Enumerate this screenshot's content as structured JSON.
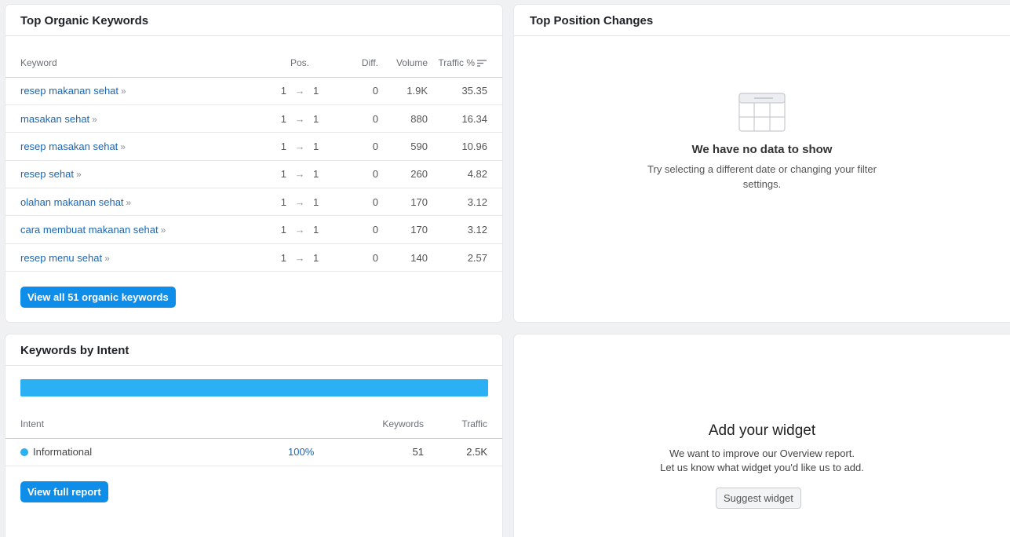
{
  "organic_keywords": {
    "title": "Top Organic Keywords",
    "columns": {
      "keyword": "Keyword",
      "pos": "Pos.",
      "diff": "Diff.",
      "volume": "Volume",
      "traffic": "Traffic %"
    },
    "rows": [
      {
        "keyword": "resep makanan sehat",
        "pos_from": "1",
        "pos_to": "1",
        "diff": "0",
        "volume": "1.9K",
        "traffic": "35.35"
      },
      {
        "keyword": "masakan sehat",
        "pos_from": "1",
        "pos_to": "1",
        "diff": "0",
        "volume": "880",
        "traffic": "16.34"
      },
      {
        "keyword": "resep masakan sehat",
        "pos_from": "1",
        "pos_to": "1",
        "diff": "0",
        "volume": "590",
        "traffic": "10.96"
      },
      {
        "keyword": "resep sehat",
        "pos_from": "1",
        "pos_to": "1",
        "diff": "0",
        "volume": "260",
        "traffic": "4.82"
      },
      {
        "keyword": "olahan makanan sehat",
        "pos_from": "1",
        "pos_to": "1",
        "diff": "0",
        "volume": "170",
        "traffic": "3.12"
      },
      {
        "keyword": "cara membuat makanan sehat",
        "pos_from": "1",
        "pos_to": "1",
        "diff": "0",
        "volume": "170",
        "traffic": "3.12"
      },
      {
        "keyword": "resep menu sehat",
        "pos_from": "1",
        "pos_to": "1",
        "diff": "0",
        "volume": "140",
        "traffic": "2.57"
      }
    ],
    "arrow_glyph": "→",
    "chevron_glyph": "»",
    "view_all_label": "View all 51 organic keywords"
  },
  "position_changes": {
    "title": "Top Position Changes",
    "empty_title": "We have no data to show",
    "empty_text": "Try selecting a different date or changing your filter settings."
  },
  "intent": {
    "title": "Keywords by Intent",
    "bar_fill_fraction": 1.0,
    "columns": {
      "intent": "Intent",
      "keywords": "Keywords",
      "traffic": "Traffic"
    },
    "rows": [
      {
        "intent": "Informational",
        "percent": "100%",
        "keywords": "51",
        "traffic": "2.5K",
        "color": "#2bb0f3"
      }
    ],
    "view_full_label": "View full report"
  },
  "widget": {
    "title": "Add your widget",
    "text_line1": "We want to improve our Overview report.",
    "text_line2": "Let us know what widget you'd like us to add.",
    "suggest_label": "Suggest widget"
  },
  "colors": {
    "link": "#1a66b3",
    "primary_button": "#0f8ee9",
    "intent_bar": "#2bb0f3"
  }
}
